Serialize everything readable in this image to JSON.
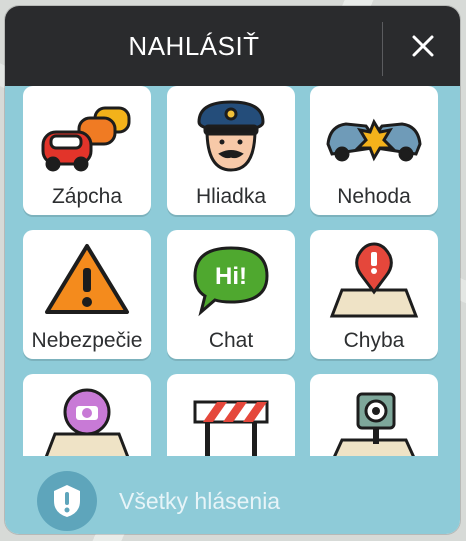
{
  "header": {
    "title": "NAHLÁSIŤ",
    "close_icon": "close-icon"
  },
  "tiles": [
    {
      "label": "Zápcha",
      "icon": "traffic-jam-icon"
    },
    {
      "label": "Hliadka",
      "icon": "police-icon"
    },
    {
      "label": "Nehoda",
      "icon": "accident-icon"
    },
    {
      "label": "Nebezpečie",
      "icon": "hazard-icon"
    },
    {
      "label": "Chat",
      "icon": "chat-icon"
    },
    {
      "label": "Chyba",
      "icon": "map-error-icon"
    },
    {
      "label": "",
      "icon": "camera-pin-icon"
    },
    {
      "label": "",
      "icon": "road-closure-icon"
    },
    {
      "label": "",
      "icon": "speed-camera-icon"
    }
  ],
  "footer": {
    "label": "Všetky hlásenia",
    "icon": "report-alert-icon"
  },
  "colors": {
    "header_bg": "#2a2b2d",
    "grid_bg": "#8ecbd8",
    "footer_icon_bg": "#5ea5bb"
  }
}
